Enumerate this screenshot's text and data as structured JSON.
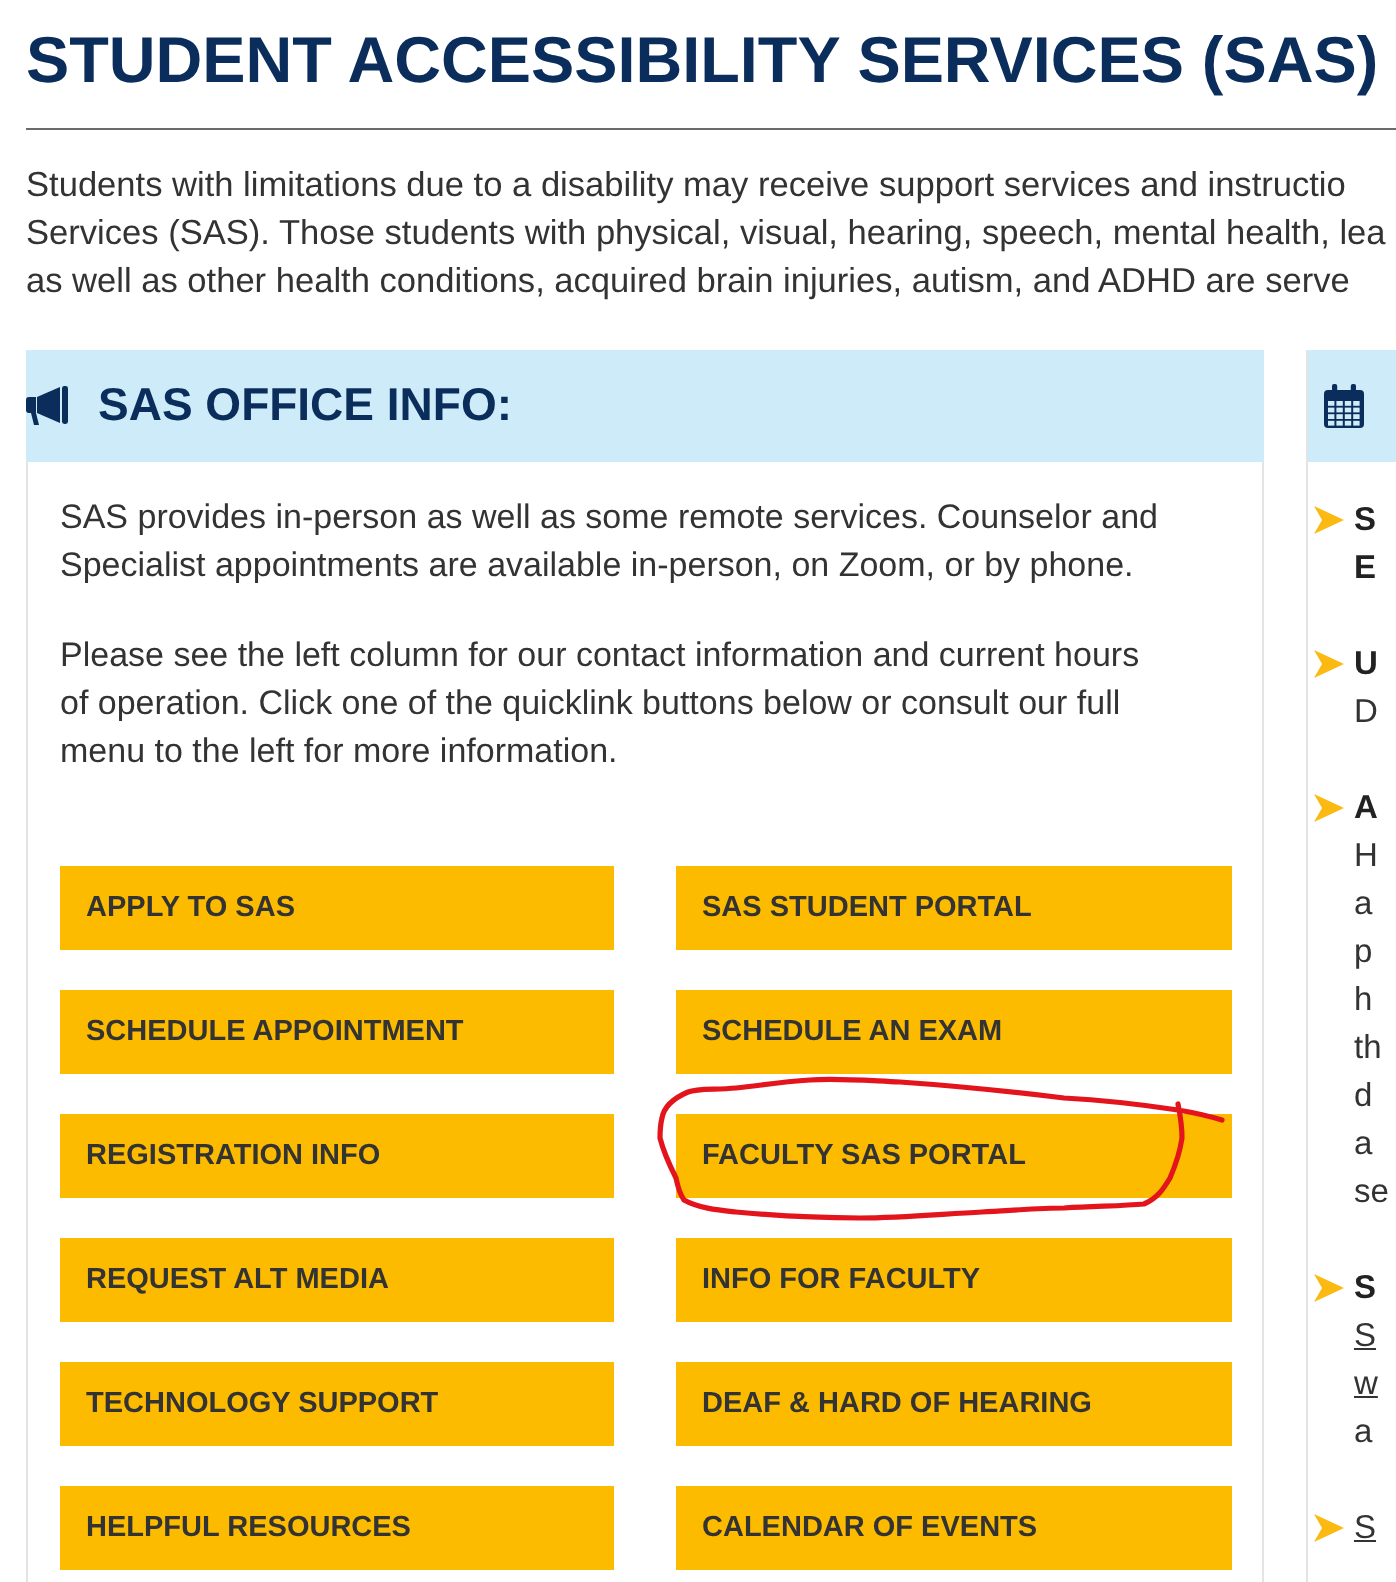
{
  "page": {
    "title": "STUDENT ACCESSIBILITY SERVICES (SAS)"
  },
  "intro_lines": [
    "Students with limitations due to a disability may receive support services and instructio",
    "Services (SAS). Those students with physical, visual, hearing, speech, mental health, lea",
    "as well as other health conditions, acquired brain injuries, autism, and ADHD are serve"
  ],
  "office_info": {
    "heading": "SAS OFFICE INFO:",
    "paragraphs": [
      "SAS provides in-person as well as some remote services. Counselor and Specialist appointments are available in-person, on Zoom, or by phone.",
      "Please see the left column for our contact information and current hours of operation. Click one of the quicklink buttons below or consult our full menu to the left for more information."
    ],
    "quicklinks": [
      {
        "label": "APPLY TO SAS",
        "circled": false
      },
      {
        "label": "SAS STUDENT PORTAL",
        "circled": false
      },
      {
        "label": "SCHEDULE APPOINTMENT",
        "circled": false
      },
      {
        "label": "SCHEDULE AN EXAM",
        "circled": false
      },
      {
        "label": "REGISTRATION INFO",
        "circled": false
      },
      {
        "label": "FACULTY SAS PORTAL",
        "circled": true
      },
      {
        "label": "REQUEST ALT MEDIA",
        "circled": false
      },
      {
        "label": "INFO FOR FACULTY",
        "circled": false
      },
      {
        "label": "TECHNOLOGY SUPPORT",
        "circled": false
      },
      {
        "label": "DEAF & HARD OF HEARING",
        "circled": false
      },
      {
        "label": "HELPFUL RESOURCES",
        "circled": false
      },
      {
        "label": "CALENDAR OF EVENTS",
        "circled": false
      }
    ]
  },
  "side_panel": {
    "items": [
      {
        "lines": [
          {
            "kind": "title",
            "text": "S"
          },
          {
            "kind": "title",
            "text": "E"
          }
        ]
      },
      {
        "lines": [
          {
            "kind": "title",
            "text": "U"
          },
          {
            "kind": "text",
            "text": "D"
          }
        ]
      },
      {
        "lines": [
          {
            "kind": "title",
            "text": "A"
          },
          {
            "kind": "text",
            "text": "H"
          },
          {
            "kind": "text",
            "text": "a"
          },
          {
            "kind": "text",
            "text": "p"
          },
          {
            "kind": "text",
            "text": "h"
          },
          {
            "kind": "text",
            "text": "th"
          },
          {
            "kind": "text",
            "text": "d"
          },
          {
            "kind": "text",
            "text": "a"
          },
          {
            "kind": "text",
            "text": "se"
          }
        ]
      },
      {
        "lines": [
          {
            "kind": "title",
            "text": "S"
          },
          {
            "kind": "link",
            "text": "S"
          },
          {
            "kind": "link",
            "text": "w"
          },
          {
            "kind": "text",
            "text": "a"
          }
        ]
      },
      {
        "lines": [
          {
            "kind": "link",
            "text": "S"
          }
        ]
      }
    ]
  }
}
